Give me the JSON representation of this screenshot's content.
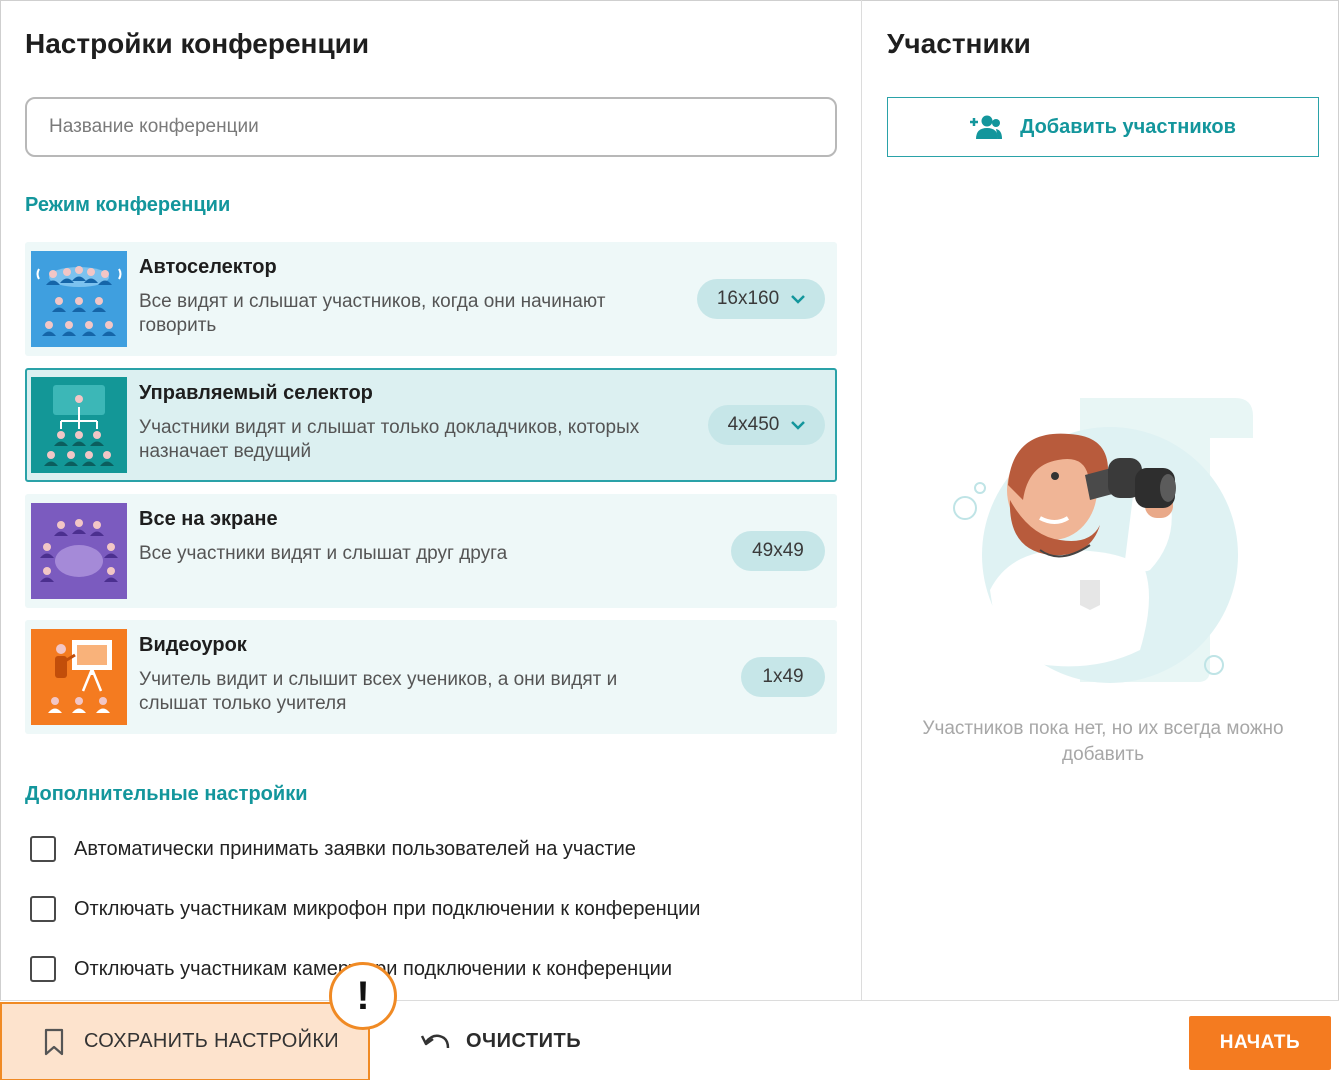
{
  "settings": {
    "title": "Настройки конференции",
    "name_placeholder": "Название конференции",
    "modes_label": "Режим конференции",
    "modes": [
      {
        "title": "Автоселектор",
        "description": "Все видят и слышат участников, когда они начинают говорить",
        "size": "16x160",
        "has_dropdown": true,
        "thumb_color": "#3f9fdf",
        "icon": "auto-selector-icon"
      },
      {
        "title": "Управляемый селектор",
        "description": "Участники видят и слышат только докладчиков, которых назначает ведущий",
        "size": "4x450",
        "has_dropdown": true,
        "thumb_color": "#139797",
        "icon": "managed-selector-icon"
      },
      {
        "title": "Все на экране",
        "description": "Все участники видят и слышат друг друга",
        "size": "49x49",
        "has_dropdown": false,
        "thumb_color": "#7b5bbf",
        "icon": "all-on-screen-icon"
      },
      {
        "title": "Видеоурок",
        "description": "Учитель видит и слышит всех учеников, а они видят и слышат только учителя",
        "size": "1x49",
        "has_dropdown": false,
        "thumb_color": "#f47b20",
        "icon": "video-lesson-icon"
      }
    ],
    "extra_label": "Дополнительные настройки",
    "options": [
      "Автоматически принимать заявки пользователей на участие",
      "Отключать участникам микрофон при подключении к конференции",
      "Отключать участникам камеру при подключении к конференции"
    ]
  },
  "participants": {
    "title": "Участники",
    "add_label": "Добавить участников",
    "empty_text": "Участников пока нет, но их всегда можно добавить"
  },
  "footer": {
    "save_label": "СОХРАНИТЬ НАСТРОЙКИ",
    "warning_mark": "!",
    "clear_label": "ОЧИСТИТЬ",
    "start_label": "НАЧАТЬ"
  },
  "colors": {
    "accent": "#13969c",
    "primary_button": "#f47b20",
    "save_highlight": "#fde3cd"
  }
}
